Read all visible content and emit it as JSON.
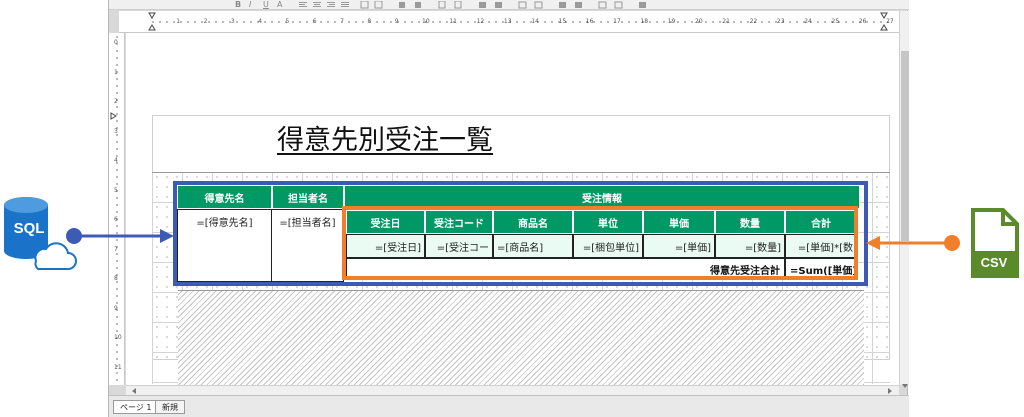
{
  "toolbar": {
    "buttons": [
      "B",
      "I",
      "U",
      "A"
    ]
  },
  "ruler": {
    "h_numbers": [
      "1",
      "2",
      "3",
      "4",
      "5",
      "6",
      "7",
      "8",
      "9",
      "10",
      "11",
      "12",
      "13",
      "14",
      "15",
      "16",
      "17",
      "18",
      "19",
      "20",
      "21",
      "22",
      "23",
      "24",
      "25",
      "26",
      "27"
    ],
    "v_numbers": [
      "0",
      "1",
      "2",
      "3",
      "4",
      "5",
      "6",
      "7",
      "8",
      "9",
      "10",
      "11"
    ]
  },
  "report": {
    "title": "得意先別受注一覧",
    "headers": {
      "customer": "得意先名",
      "staff": "担当者名",
      "order_info": "受注情報",
      "order_date": "受注日",
      "order_code": "受注コード",
      "product": "商品名",
      "unit": "単位",
      "price": "単価",
      "qty": "数量",
      "total": "合計"
    },
    "fields": {
      "customer": "=[得意先名]",
      "staff": "=[担当者名]",
      "order_date": "=[受注日]",
      "order_code": "=[受注コー",
      "product": "=[商品名]",
      "unit": "=[梱包単位]",
      "price": "=[単価]",
      "qty": "=[数量]",
      "total": "=[単価]*[数"
    },
    "summary_label": "得意先受注合計",
    "summary_expr": "=Sum([単価]"
  },
  "tabs": [
    "ページ 1",
    "新規"
  ],
  "annotations": {
    "left_icon": "SQL",
    "right_icon": "CSV"
  },
  "colors": {
    "header_green": "#009966",
    "blue": "#3d5bb5",
    "orange": "#f07f2b",
    "csv_green": "#5a8a2a",
    "sql_blue": "#1a73c8"
  }
}
